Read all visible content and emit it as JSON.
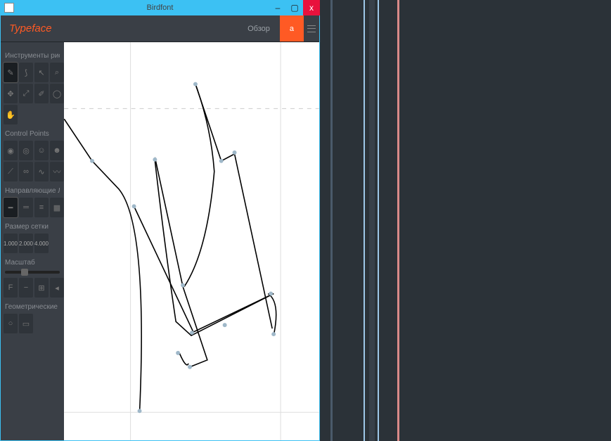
{
  "window": {
    "title": "Birdfont",
    "min": "–",
    "max": "▢",
    "close": "x"
  },
  "brand": "Typeface",
  "tabs": {
    "overview": "Обзор",
    "glyph": "a",
    "menu": ""
  },
  "sidebar": {
    "drawing_label": "Инструменты рисования",
    "control_points_label": "Control Points",
    "guides_label": "Направляющие Линии и С",
    "grid_size_label": "Размер сетки",
    "scale_label": "Масштаб",
    "shapes_label": "Геометрические фигуры",
    "grid_values": {
      "v1": "1.000",
      "v2": "2.000",
      "v3": "4.000"
    },
    "scale_btns": {
      "a": "F",
      "b": "−",
      "c": "⊞",
      "d": "◂"
    }
  },
  "right_lines": {
    "colors": [
      "#4a5a6a",
      "#9ec7e8",
      "#384049",
      "#9ec7e8",
      "#d98a88"
    ],
    "positions": [
      15,
      62,
      70,
      82,
      110
    ]
  }
}
